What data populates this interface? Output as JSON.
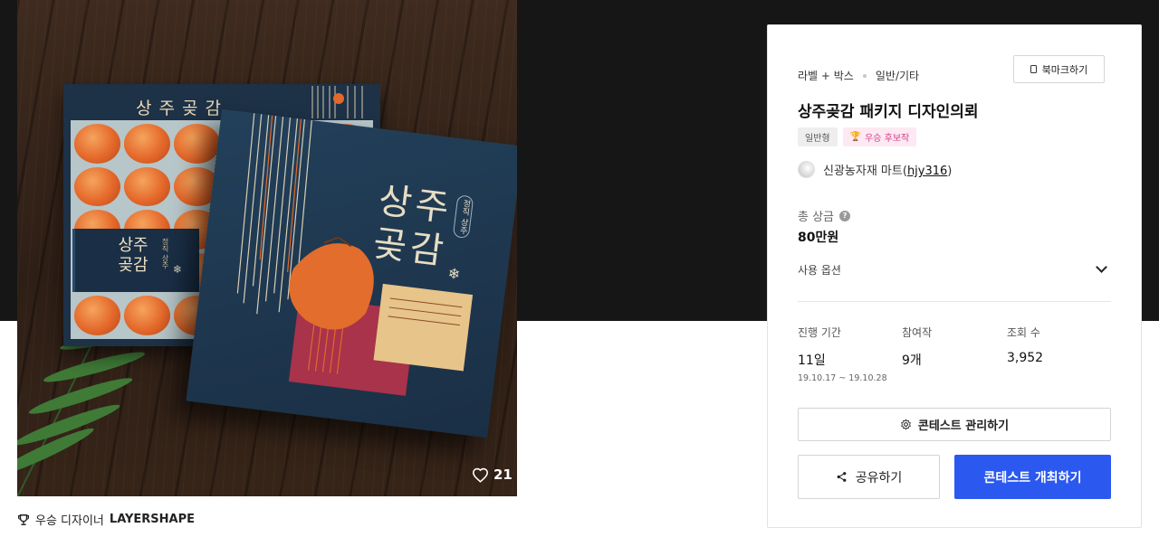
{
  "image": {
    "tray_title": "상주곶감",
    "tray_band_text": "상주\n곶감",
    "box_title": "상주\n곶감",
    "box_sub": "정직 상주",
    "likes": "21"
  },
  "winner": {
    "prefix": "우승 디자이너",
    "name": "LAYERSHAPE"
  },
  "contest": {
    "category": "라벨 + 박스",
    "subcategory": "일반/기타",
    "bookmark_label": "북마크하기",
    "title": "상주곶감 패키지 디자인의뢰",
    "tags": {
      "type": "일반형",
      "award": "우승 후보작"
    },
    "owner": {
      "name": "신광농자재 마트",
      "open": "(",
      "id": "hjy316",
      "close": ")"
    },
    "prize": {
      "label": "총 상금",
      "help": "?",
      "value": "80만원"
    },
    "usage_label": "사용 옵션",
    "stats": {
      "period": {
        "label": "진행 기간",
        "value": "11일",
        "range": "19.10.17 ~ 19.10.28"
      },
      "entries": {
        "label": "참여작",
        "value": "9개"
      },
      "views": {
        "label": "조회 수",
        "value": "3,952"
      }
    },
    "manage_label": "콘테스트 관리하기",
    "share_label": "공유하기",
    "host_label": "콘테스트 개최하기"
  },
  "colors": {
    "accent": "#2b59f0",
    "hero_bg": "#161616",
    "award_tag_text": "#d43f8a",
    "award_tag_bg": "#fde9f3"
  }
}
